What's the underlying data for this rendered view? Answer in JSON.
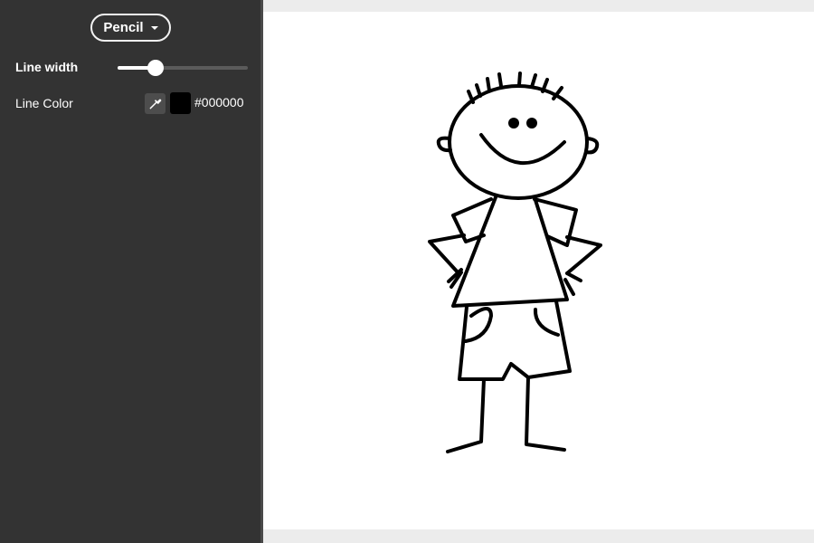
{
  "toolbar": {
    "tool_label": "Pencil",
    "tool_icon": "caret-down-icon"
  },
  "line_width": {
    "label": "Line width",
    "value": 0.29
  },
  "line_color": {
    "label": "Line Color",
    "picker_icon": "eyedropper-icon",
    "swatch_color": "#000000",
    "hex_value": "#000000"
  },
  "colors": {
    "sidebar_bg": "#333333",
    "canvas_bg": "#ffffff",
    "page_bg": "#ececec"
  },
  "canvas": {
    "drawing": "stick-figure-boy"
  }
}
